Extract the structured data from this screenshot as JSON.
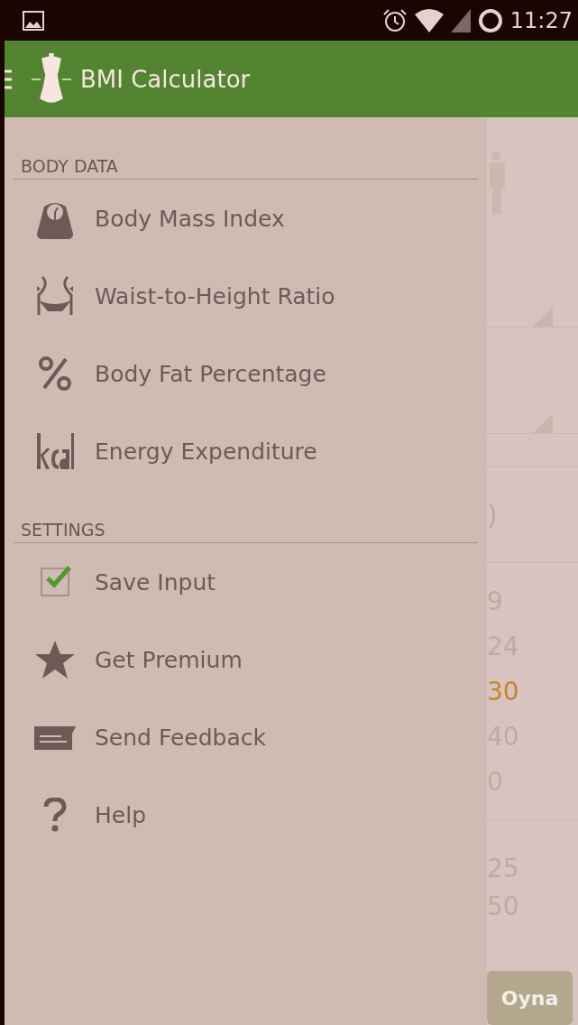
{
  "status_bar": {
    "time": "11:27"
  },
  "app_bar": {
    "title": "BMI Calculator"
  },
  "drawer": {
    "sections": [
      {
        "header": "BODY DATA",
        "items": [
          {
            "kind": "link",
            "label": "Body Mass Index"
          },
          {
            "kind": "link",
            "label": "Waist-to-Height Ratio"
          },
          {
            "kind": "link",
            "label": "Body Fat Percentage"
          },
          {
            "kind": "link",
            "label": "Energy Expenditure"
          }
        ]
      },
      {
        "header": "SETTINGS",
        "items": [
          {
            "kind": "checkbox",
            "label": "Save Input",
            "checked": true
          },
          {
            "kind": "link",
            "label": "Get Premium"
          },
          {
            "kind": "link",
            "label": "Send Feedback"
          },
          {
            "kind": "link",
            "label": "Help"
          }
        ]
      }
    ]
  },
  "background": {
    "note": ")",
    "values": [
      {
        "text": "9",
        "highlighted": false
      },
      {
        "text": "24",
        "highlighted": false
      },
      {
        "text": "30",
        "highlighted": true
      },
      {
        "text": "40",
        "highlighted": false
      },
      {
        "text": "0",
        "highlighted": false
      }
    ],
    "values_2": [
      "25",
      "50"
    ],
    "button": "Oyna"
  }
}
